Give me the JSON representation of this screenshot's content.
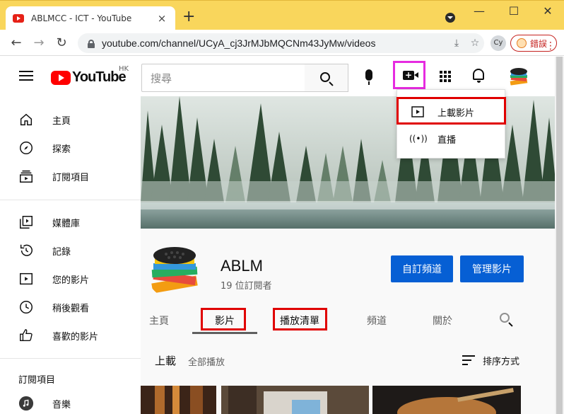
{
  "browser": {
    "tab_title": "ABLMCC - ICT - YouTube",
    "tab_close": "×",
    "new_tab": "+",
    "minimize": "—",
    "maximize": "☐",
    "close": "✕",
    "url": "youtube.com/channel/UCyA_cj3JrMJbMQCNm43JyMw/videos",
    "profile_initials": "Cy",
    "error_label": "錯誤",
    "back": "←",
    "forward": "→",
    "reload": "↻",
    "install_icon": "⤓",
    "star_icon": "☆",
    "more_icon": "⋮"
  },
  "youtube": {
    "logo_text": "YouTube",
    "region": "HK",
    "search_placeholder": "搜尋"
  },
  "sidebar": {
    "items": [
      {
        "label": "主頁",
        "icon": "home-icon"
      },
      {
        "label": "探索",
        "icon": "compass-icon"
      },
      {
        "label": "訂閱項目",
        "icon": "subscriptions-icon"
      },
      {
        "label": "媒體庫",
        "icon": "library-icon"
      },
      {
        "label": "記錄",
        "icon": "history-icon"
      },
      {
        "label": "您的影片",
        "icon": "your-videos-icon"
      },
      {
        "label": "稍後觀看",
        "icon": "watch-later-icon"
      },
      {
        "label": "喜歡的影片",
        "icon": "liked-icon"
      }
    ],
    "section_title": "訂閱項目",
    "subscription": {
      "label": "音樂",
      "icon": "music-icon"
    }
  },
  "create_menu": {
    "items": [
      {
        "label": "上載影片",
        "icon": "upload-video-icon"
      },
      {
        "label": "直播",
        "icon": "live-icon"
      }
    ]
  },
  "channel": {
    "name": "ABLM",
    "subscribers": "19 位訂閱者",
    "customize_button": "自訂頻道",
    "manage_button": "管理影片",
    "tabs": [
      "主頁",
      "影片",
      "播放清單",
      "頻道",
      "關於"
    ],
    "active_tab": "影片"
  },
  "videos_section": {
    "title": "上載",
    "play_all": "全部播放",
    "sort_label": "排序方式"
  },
  "colors": {
    "youtube_red": "#ff0000",
    "primary_blue": "#065fd4",
    "highlight_magenta": "#e62be0",
    "highlight_red": "#e00000",
    "tabbar_yellow": "#f9d65c"
  }
}
